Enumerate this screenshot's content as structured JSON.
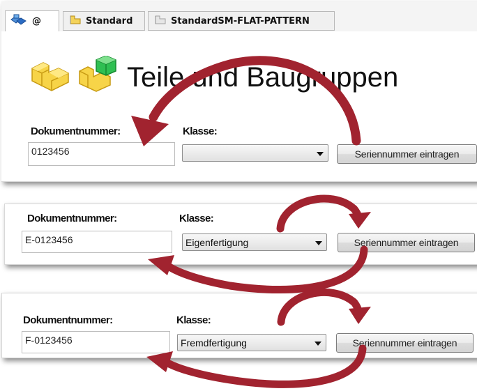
{
  "tabs": [
    {
      "label": "@",
      "icon": "assembly-icon"
    },
    {
      "label": "Standard",
      "icon": "part-icon"
    },
    {
      "label": "StandardSM-FLAT-PATTERN",
      "icon": "flat-pattern-icon"
    }
  ],
  "header": {
    "title": "Teile und Baugruppen"
  },
  "forms": [
    {
      "doc_label": "Dokumentnummer:",
      "doc_value": "0123456",
      "class_label": "Klasse:",
      "class_value": "",
      "button_label": "Seriennummer eintragen"
    },
    {
      "doc_label": "Dokumentnummer:",
      "doc_value": "E-0123456",
      "class_label": "Klasse:",
      "class_value": "Eigenfertigung",
      "button_label": "Seriennummer eintragen"
    },
    {
      "doc_label": "Dokumentnummer:",
      "doc_value": "F-0123456",
      "class_label": "Klasse:",
      "class_value": "Fremdfertigung",
      "button_label": "Seriennummer eintragen"
    }
  ],
  "colors": {
    "arrow": "#a1232f",
    "part_yellow": "#f2c318",
    "part_green": "#27b24a"
  }
}
